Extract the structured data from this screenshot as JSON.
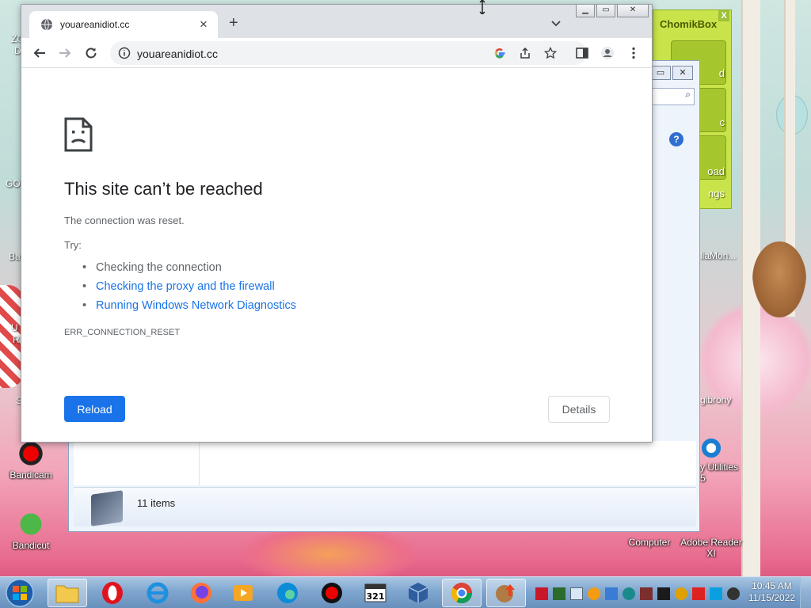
{
  "browser": {
    "tab_title": "youareanidiot.cc",
    "new_tab_label": "+",
    "url": "youareanidiot.cc"
  },
  "error_page": {
    "title": "This site can’t be reached",
    "subtitle": "The connection was reset.",
    "try_label": "Try:",
    "suggestions": [
      "Checking the connection",
      "Checking the proxy and the firewall",
      "Running Windows Network Diagnostics"
    ],
    "error_code": "ERR_CONNECTION_RESET",
    "reload_label": "Reload",
    "details_label": "Details"
  },
  "chomikbox": {
    "title": "ChomikBox",
    "close_label": "X",
    "cut_labels": [
      "d",
      "c",
      "oad",
      "ngs"
    ]
  },
  "explorer": {
    "item_count": "11 items"
  },
  "desktop": {
    "icons": {
      "bandicam": "Bandicam",
      "bandicut": "Bandicut",
      "computer": "Computer",
      "adobe_reader": "Adobe Reader XI",
      "utilities": "y Utilities 5",
      "mediamon": "liaMon...",
      "bigbrony": "gibrony"
    },
    "edge_texts": [
      "ZC",
      "D",
      "GO",
      "Ba",
      "U",
      "R",
      "S"
    ]
  },
  "taskbar": {
    "time": "10:45 AM",
    "date": "11/15/2022"
  },
  "colors": {
    "reload_blue": "#1a73e8",
    "link_blue": "#1a73e8",
    "chomik_green": "#c9e34a",
    "taskbar_blue": "#7fa6cf"
  }
}
